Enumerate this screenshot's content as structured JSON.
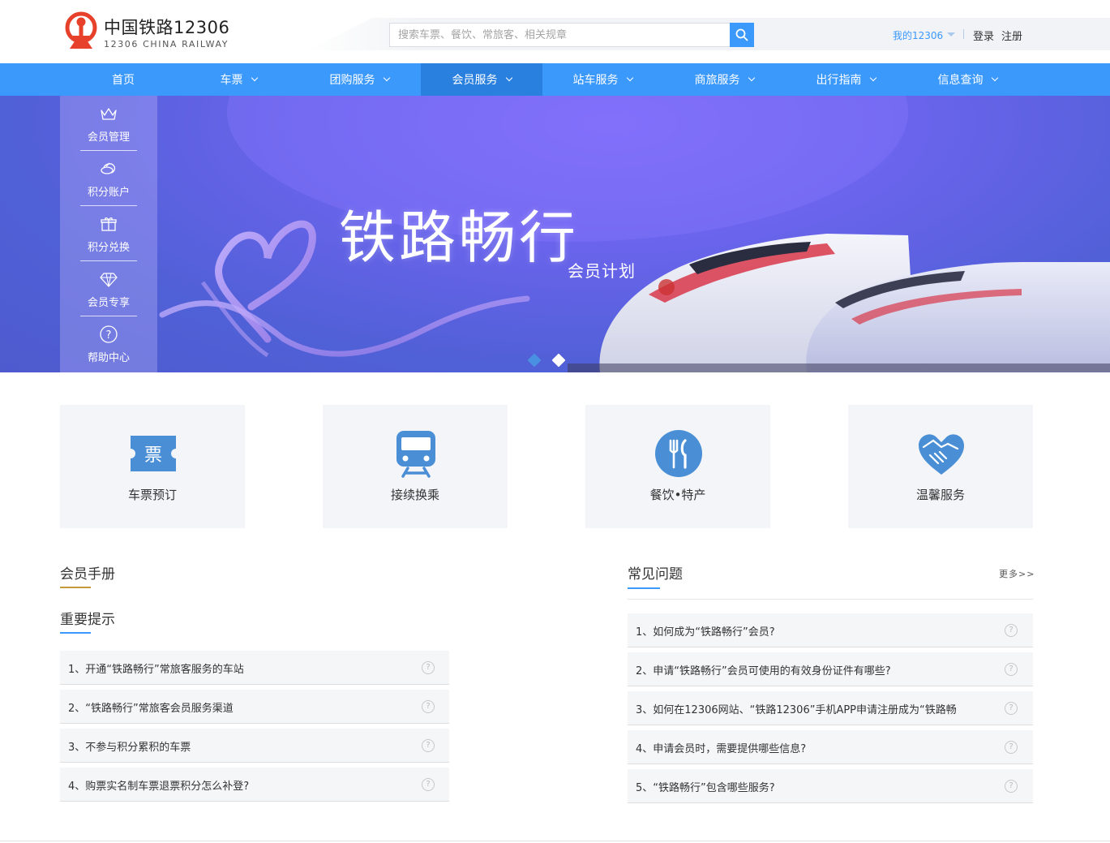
{
  "header": {
    "logo_title": "中国铁路12306",
    "logo_subtitle": "12306 CHINA RAILWAY",
    "search_placeholder": "搜索车票、餐饮、常旅客、相关规章",
    "my12306": "我的12306",
    "login": "登录",
    "register": "注册",
    "colors": {
      "brand_red": "#e7412b",
      "accent_blue": "#3b99fc"
    }
  },
  "nav": {
    "items": [
      {
        "label": "首页",
        "has_dropdown": false,
        "active": false
      },
      {
        "label": "车票",
        "has_dropdown": true,
        "active": false
      },
      {
        "label": "团购服务",
        "has_dropdown": true,
        "active": false
      },
      {
        "label": "会员服务",
        "has_dropdown": true,
        "active": true
      },
      {
        "label": "站车服务",
        "has_dropdown": true,
        "active": false
      },
      {
        "label": "商旅服务",
        "has_dropdown": true,
        "active": false
      },
      {
        "label": "出行指南",
        "has_dropdown": true,
        "active": false
      },
      {
        "label": "信息查询",
        "has_dropdown": true,
        "active": false
      }
    ]
  },
  "sidemenu": {
    "items": [
      {
        "label": "会员管理",
        "icon": "crown-icon"
      },
      {
        "label": "积分账户",
        "icon": "coins-icon"
      },
      {
        "label": "积分兑换",
        "icon": "gift-icon"
      },
      {
        "label": "会员专享",
        "icon": "diamond-icon"
      },
      {
        "label": "帮助中心",
        "icon": "help-icon"
      }
    ]
  },
  "banner": {
    "title": "铁路畅行",
    "subtitle": "会员计划",
    "slide_count": 2,
    "active_slide": 1
  },
  "services": [
    {
      "label": "车票预订",
      "icon": "ticket-icon",
      "icon_text": "票"
    },
    {
      "label": "接续换乘",
      "icon": "train-icon"
    },
    {
      "label": "餐饮•特产",
      "icon": "dining-icon"
    },
    {
      "label": "温馨服务",
      "icon": "heart-hands-icon"
    }
  ],
  "handbook": {
    "title": "会员手册",
    "subtitle": "重要提示",
    "items": [
      "1、开通“铁路畅行”常旅客服务的车站",
      "2、“铁路畅行”常旅客会员服务渠道",
      "3、不参与积分累积的车票",
      "4、购票实名制车票退票积分怎么补登?"
    ]
  },
  "faq": {
    "title": "常见问题",
    "more": "更多>>",
    "items": [
      "1、如何成为“铁路畅行”会员?",
      "2、申请“铁路畅行”会员可使用的有效身份证件有哪些?",
      "3、如何在12306网站、“铁路12306”手机APP申请注册成为“铁路畅",
      "4、申请会员时，需要提供哪些信息?",
      "5、“铁路畅行”包含哪些服务?"
    ]
  }
}
